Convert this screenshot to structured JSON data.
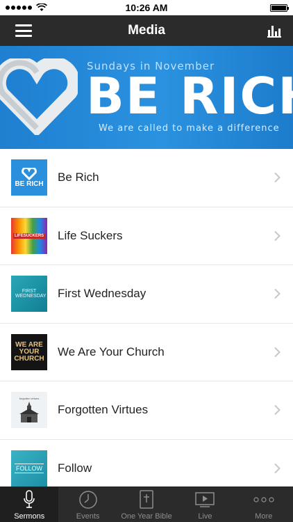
{
  "status_bar": {
    "time": "10:26 AM"
  },
  "nav": {
    "title": "Media"
  },
  "banner": {
    "subtitle": "Sundays in November",
    "title": "BE RICH",
    "tagline": "We are called to make a difference"
  },
  "series": [
    {
      "label": "Be Rich",
      "thumb_text": "BE RICH"
    },
    {
      "label": "Life Suckers",
      "thumb_text": "LIFESUCKERS"
    },
    {
      "label": "First Wednesday",
      "thumb_text": "FIRST WEDNESDAY"
    },
    {
      "label": "We Are Your Church",
      "thumb_text_1": "WE ARE",
      "thumb_text_2": "YOUR",
      "thumb_text_3": "CHURCH"
    },
    {
      "label": "Forgotten Virtues",
      "thumb_text": "forgotten virtues"
    },
    {
      "label": "Follow",
      "thumb_text": "FOLLOW"
    }
  ],
  "tabs": [
    {
      "label": "Sermons",
      "icon": "microphone-icon",
      "active": true
    },
    {
      "label": "Events",
      "icon": "clock-icon",
      "active": false
    },
    {
      "label": "One Year Bible",
      "icon": "bible-icon",
      "active": false
    },
    {
      "label": "Live",
      "icon": "play-screen-icon",
      "active": false
    },
    {
      "label": "More",
      "icon": "more-dots-icon",
      "active": false
    }
  ],
  "colors": {
    "nav_bg": "#2b2b2b",
    "banner_blue": "#2a92e0",
    "text": "#222222"
  }
}
